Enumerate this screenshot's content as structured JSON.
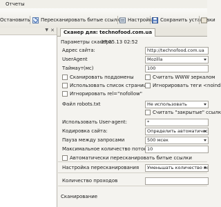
{
  "menu": {
    "reports": "Отчеты"
  },
  "toolbar": {
    "stop": "Остановить",
    "rescan": "Пересканировать битые ссылки",
    "settings": "Настройки",
    "save_settings": "Сохранить установки"
  },
  "tab": {
    "title": "Сканер для: technofood.com.ua"
  },
  "scanner": {
    "params_label": "Параметры сканера",
    "params_date": "27.05.13 02:52",
    "site_label": "Адрес сайта:",
    "site_value": "http://technofood.com.ua",
    "useragent_label": "UserAgent",
    "useragent_value": "Mozilla",
    "timeout_label": "Таймаут(мс)",
    "timeout_value": "100",
    "scan_subdomains": "Сканировать поддомены",
    "www_mirror": "Считать WWW зеркалом",
    "use_page_list": "Использовать список страниц",
    "ignore_noindex": "Игнорировать теги <noindex>",
    "ignore_nofollow": "Игнорировать rel=\"nofollow\"",
    "robots_label": "Файл robots.txt",
    "robots_value": "Не использовать",
    "closed_links": "Считать \"закрытые\" ссылки",
    "use_ua_label": "Использовать User-agent:",
    "use_ua_value": "*",
    "encoding_label": "Кодировка сайта:",
    "encoding_value": "Определить автоматически",
    "pause_label": "Пауза между запросами",
    "pause_value": "500 мсек",
    "threads_label": "Максимальное количество потоков",
    "threads_value": "10",
    "auto_rescan": "Автоматически пересканировать битые ссылки",
    "rescan_setting_label": "Настройка пересканирования",
    "rescan_setting_value": "Уменьшать количество потоков",
    "passes_label": "Количество проходов",
    "scanning_label": "Сканирование"
  }
}
